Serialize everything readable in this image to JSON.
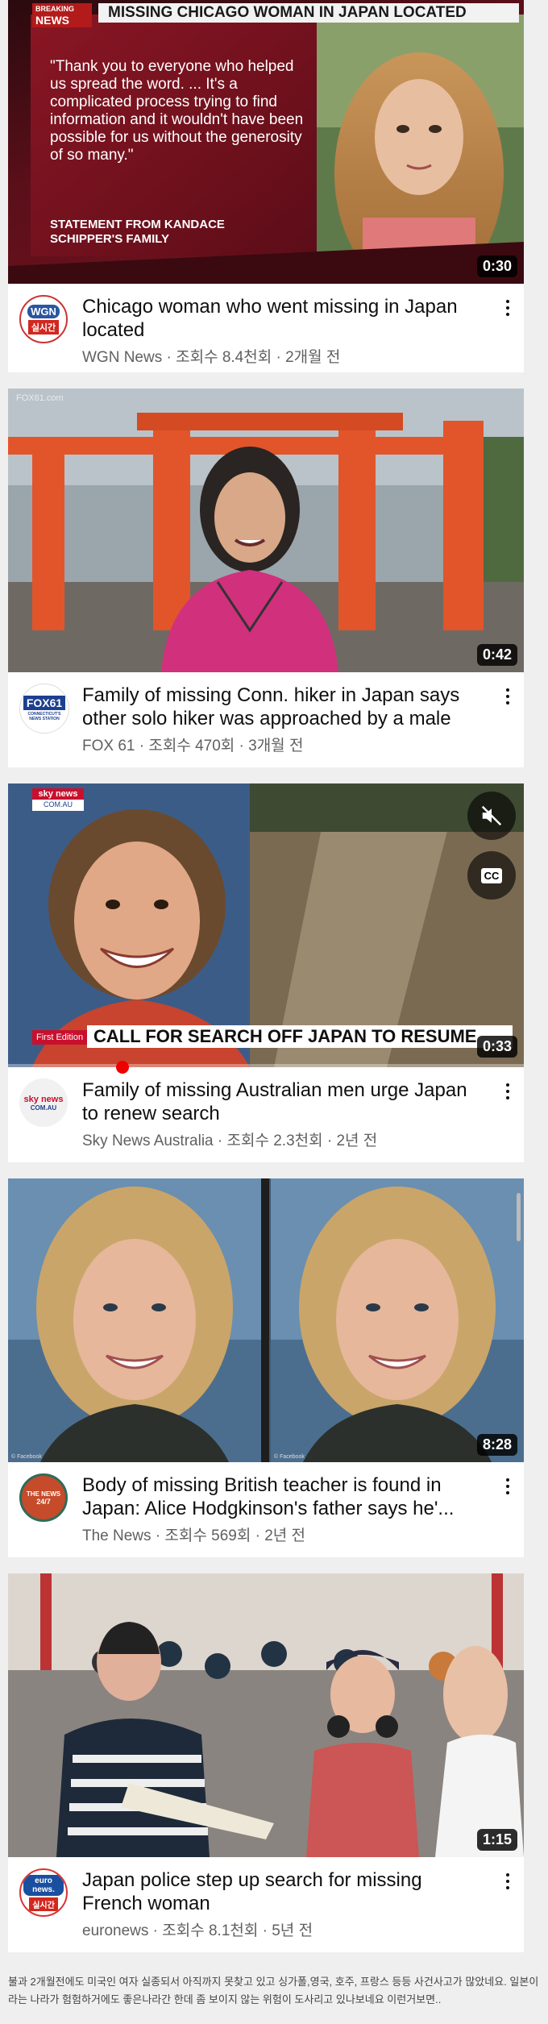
{
  "videos": [
    {
      "title": "Chicago woman who went missing in Japan located",
      "channel_line": "WGN News · 조회수 8.4천회 · 2개월 전",
      "duration": "0:30",
      "thumb": {
        "breaking": "BREAKING",
        "news": "NEWS",
        "headline": "MISSING CHICAGO WOMAN IN JAPAN LOCATED",
        "quote": "\"Thank you to everyone who helped us spread the word. ... It's a complicated process trying to find information and it wouldn't have been possible for us without the generosity of so many.\"",
        "attribution": "STATEMENT FROM KANDACE SCHIPPER'S FAMILY"
      },
      "avatar": {
        "top": "WGN",
        "bottom": "실시간"
      }
    },
    {
      "title": "Family of missing Conn. hiker in Japan says other solo hiker was approached by a male",
      "channel_line": "FOX 61 · 조회수 470회 · 3개월 전",
      "duration": "0:42",
      "thumb": {
        "watermark": "FOX61.com"
      },
      "avatar": {
        "top": "FOX61",
        "bottom": "CONNECTICUT'S NEWS STATION"
      }
    },
    {
      "title": "Family of missing Australian men urge Japan to renew search",
      "channel_line": "Sky News Australia · 조회수 2.3천회 · 2년 전",
      "duration": "0:33",
      "thumb": {
        "logo_top": "sky news",
        "logo_bottom": "COM.AU",
        "edition": "First Edition",
        "headline": "CALL FOR SEARCH OFF JAPAN TO RESUME",
        "cc": "CC"
      },
      "avatar": {
        "top": "sky news",
        "bottom": "COM.AU"
      }
    },
    {
      "title": "Body of missing British teacher is found in Japan: Alice Hodgkinson's father says he'...",
      "channel_line": "The News · 조회수 569회 · 2년 전",
      "duration": "8:28",
      "thumb": {
        "credit": "© Facebook"
      },
      "avatar": {
        "top": "THE NEWS",
        "bottom": "24/7"
      }
    },
    {
      "title": "Japan police step up search for missing French woman",
      "channel_line": "euronews · 조회수 8.1천회 · 5년 전",
      "duration": "1:15",
      "thumb": {},
      "avatar": {
        "top": "euro news.",
        "bottom": "실시간"
      }
    }
  ],
  "footer": "불과 2개월전에도 미국인 여자 실종되서 아직까지 못찾고 있고 싱가폴,영국, 호주, 프랑스 등등 사건사고가 많았네요. 일본이라는 나라가 험험하거에도 좋은나라간 한데 좀 보이지 않는 위험이 도사리고 있나보네요 이런거보면.."
}
